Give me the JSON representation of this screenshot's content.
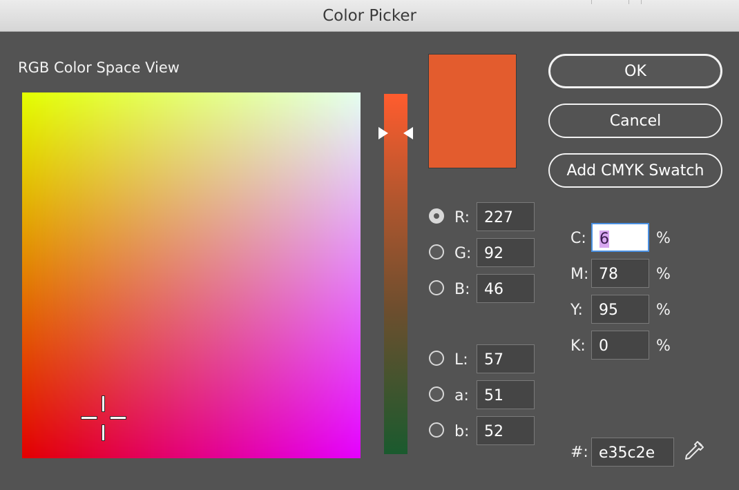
{
  "window": {
    "title": "Color Picker"
  },
  "color_space_label": "RGB Color Space View",
  "buttons": {
    "ok": "OK",
    "cancel": "Cancel",
    "add_cmyk_swatch": "Add CMYK Swatch"
  },
  "preview_color": "#e35c2e",
  "rgb": {
    "r_label": "R:",
    "r_value": "227",
    "g_label": "G:",
    "g_value": "92",
    "b_label": "B:",
    "b_value": "46"
  },
  "lab": {
    "l_label": "L:",
    "l_value": "57",
    "a_label": "a:",
    "a_value": "51",
    "b_label": "b:",
    "b_value": "52"
  },
  "cmyk": {
    "c_label": "C:",
    "c_value": "6",
    "m_label": "M:",
    "m_value": "78",
    "y_label": "Y:",
    "y_value": "95",
    "k_label": "K:",
    "k_value": "0",
    "unit": "%"
  },
  "hex": {
    "label": "#:",
    "value": "e35c2e"
  },
  "selected_channel": "R",
  "icons": {
    "eyedropper": "eyedropper-icon"
  }
}
